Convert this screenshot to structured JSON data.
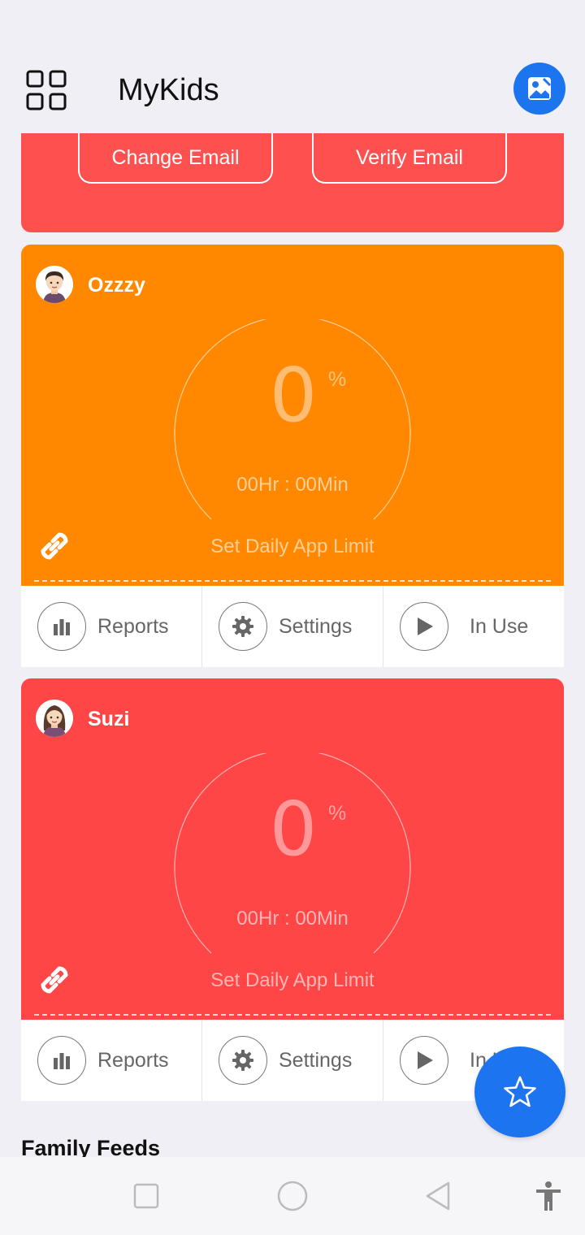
{
  "header": {
    "title": "MyKids",
    "menu_icon": "grid-menu-icon",
    "profile_icon": "image-edit-icon"
  },
  "email_banner": {
    "change_label": "Change Email",
    "verify_label": "Verify Email",
    "color": "#ff5050"
  },
  "kids": [
    {
      "name": "Ozzzy",
      "color": "#ff8800",
      "percent_value": "0",
      "percent_sign": "%",
      "time": "00Hr : 00Min",
      "limit_label": "Set Daily App Limit",
      "actions": [
        {
          "label": "Reports",
          "icon": "bar-chart-icon"
        },
        {
          "label": "Settings",
          "icon": "gear-icon"
        },
        {
          "label": "In Use",
          "icon": "play-icon"
        }
      ]
    },
    {
      "name": "Suzi",
      "color": "#ff4646",
      "percent_value": "0",
      "percent_sign": "%",
      "time": "00Hr : 00Min",
      "limit_label": "Set Daily App Limit",
      "actions": [
        {
          "label": "Reports",
          "icon": "bar-chart-icon"
        },
        {
          "label": "Settings",
          "icon": "gear-icon"
        },
        {
          "label": "In Use",
          "icon": "play-icon"
        }
      ]
    }
  ],
  "family_feeds": "Family Feeds",
  "fab_icon": "star-icon",
  "navbar": [
    "square-icon",
    "circle-icon",
    "back-triangle-icon",
    "accessibility-icon"
  ],
  "accent_color": "#1d74ef"
}
